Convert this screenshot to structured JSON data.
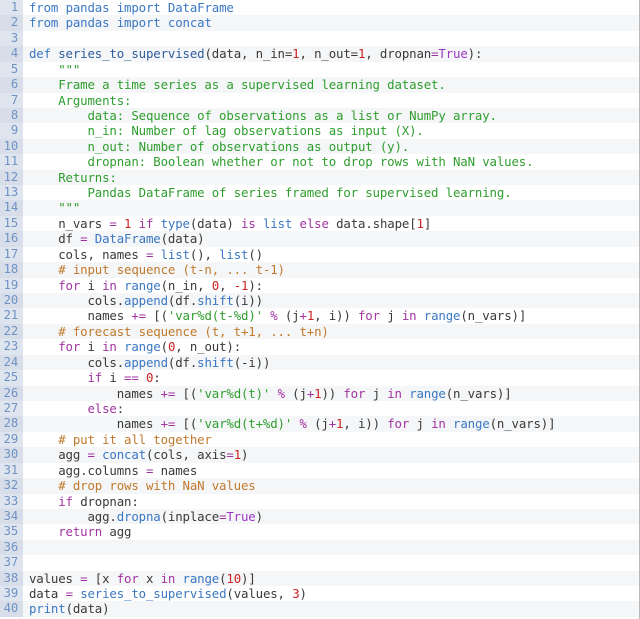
{
  "editor": {
    "name": "python-code-viewer",
    "language": "Python",
    "total_lines": 40,
    "first_line_number": 1,
    "theme": {
      "background": "#ffffff",
      "stripe_background": "#f5f6f7",
      "gutter_background": "#dfe5ee",
      "gutter_text": "#6f93c4",
      "keyword": "#3b78c3",
      "control_keyword": "#a234a2",
      "function": "#3b78c3",
      "number": "#cc2222",
      "constant": "#9b38c6",
      "string": "#2f9e2f",
      "comment": "#c07a2e",
      "plain_text": "#3a3a3a"
    }
  },
  "code": {
    "lines": [
      {
        "n": "1",
        "tokens": [
          {
            "t": "from ",
            "c": "kw"
          },
          {
            "t": "pandas ",
            "c": "fn"
          },
          {
            "t": "import ",
            "c": "kw"
          },
          {
            "t": "DataFrame",
            "c": "fn"
          }
        ]
      },
      {
        "n": "2",
        "tokens": [
          {
            "t": "from ",
            "c": "kw"
          },
          {
            "t": "pandas ",
            "c": "fn"
          },
          {
            "t": "import ",
            "c": "kw"
          },
          {
            "t": "concat",
            "c": "fn"
          }
        ]
      },
      {
        "n": "3",
        "tokens": []
      },
      {
        "n": "4",
        "tokens": [
          {
            "t": "def ",
            "c": "kw"
          },
          {
            "t": "series_to_supervised",
            "c": "def"
          },
          {
            "t": "(data, n_in=",
            "c": "plain"
          },
          {
            "t": "1",
            "c": "num"
          },
          {
            "t": ", n_out=",
            "c": "plain"
          },
          {
            "t": "1",
            "c": "num"
          },
          {
            "t": ", dropnan",
            "c": "plain"
          },
          {
            "t": "=",
            "c": "op"
          },
          {
            "t": "True",
            "c": "const"
          },
          {
            "t": "):",
            "c": "plain"
          }
        ]
      },
      {
        "n": "5",
        "tokens": [
          {
            "t": "    \"\"\"",
            "c": "str"
          }
        ]
      },
      {
        "n": "6",
        "tokens": [
          {
            "t": "    Frame a time series as a supervised learning dataset.",
            "c": "str"
          }
        ]
      },
      {
        "n": "7",
        "tokens": [
          {
            "t": "    Arguments:",
            "c": "str"
          }
        ]
      },
      {
        "n": "8",
        "tokens": [
          {
            "t": "        data: Sequence of observations as a list or NumPy array.",
            "c": "str"
          }
        ]
      },
      {
        "n": "9",
        "tokens": [
          {
            "t": "        n_in: Number of lag observations as input (X).",
            "c": "str"
          }
        ]
      },
      {
        "n": "10",
        "tokens": [
          {
            "t": "        n_out: Number of observations as output (y).",
            "c": "str"
          }
        ]
      },
      {
        "n": "11",
        "tokens": [
          {
            "t": "        dropnan: Boolean whether or not to drop rows with NaN values.",
            "c": "str"
          }
        ]
      },
      {
        "n": "12",
        "tokens": [
          {
            "t": "    Returns:",
            "c": "str"
          }
        ]
      },
      {
        "n": "13",
        "tokens": [
          {
            "t": "        Pandas DataFrame of series framed for supervised learning.",
            "c": "str"
          }
        ]
      },
      {
        "n": "14",
        "tokens": [
          {
            "t": "    \"\"\"",
            "c": "str"
          }
        ]
      },
      {
        "n": "15",
        "tokens": [
          {
            "t": "    n_vars ",
            "c": "plain"
          },
          {
            "t": "=",
            "c": "op"
          },
          {
            "t": " ",
            "c": "plain"
          },
          {
            "t": "1",
            "c": "num"
          },
          {
            "t": " ",
            "c": "plain"
          },
          {
            "t": "if ",
            "c": "ctrl"
          },
          {
            "t": "type",
            "c": "fn"
          },
          {
            "t": "(data) ",
            "c": "plain"
          },
          {
            "t": "is ",
            "c": "ctrl"
          },
          {
            "t": "list ",
            "c": "fn"
          },
          {
            "t": "else ",
            "c": "ctrl"
          },
          {
            "t": "data.shape[",
            "c": "plain"
          },
          {
            "t": "1",
            "c": "num"
          },
          {
            "t": "]",
            "c": "plain"
          }
        ]
      },
      {
        "n": "16",
        "tokens": [
          {
            "t": "    df ",
            "c": "plain"
          },
          {
            "t": "=",
            "c": "op"
          },
          {
            "t": " ",
            "c": "plain"
          },
          {
            "t": "DataFrame",
            "c": "fn"
          },
          {
            "t": "(data)",
            "c": "plain"
          }
        ]
      },
      {
        "n": "17",
        "tokens": [
          {
            "t": "    cols, names ",
            "c": "plain"
          },
          {
            "t": "=",
            "c": "op"
          },
          {
            "t": " ",
            "c": "plain"
          },
          {
            "t": "list",
            "c": "fn"
          },
          {
            "t": "(), ",
            "c": "plain"
          },
          {
            "t": "list",
            "c": "fn"
          },
          {
            "t": "()",
            "c": "plain"
          }
        ]
      },
      {
        "n": "18",
        "tokens": [
          {
            "t": "    # input sequence (t-n, ... t-1)",
            "c": "com"
          }
        ]
      },
      {
        "n": "19",
        "tokens": [
          {
            "t": "    ",
            "c": "plain"
          },
          {
            "t": "for ",
            "c": "ctrl"
          },
          {
            "t": "i ",
            "c": "plain"
          },
          {
            "t": "in ",
            "c": "ctrl"
          },
          {
            "t": "range",
            "c": "fn"
          },
          {
            "t": "(n_in, ",
            "c": "plain"
          },
          {
            "t": "0",
            "c": "num"
          },
          {
            "t": ", ",
            "c": "plain"
          },
          {
            "t": "-1",
            "c": "num"
          },
          {
            "t": "):",
            "c": "plain"
          }
        ]
      },
      {
        "n": "20",
        "tokens": [
          {
            "t": "        cols.",
            "c": "plain"
          },
          {
            "t": "append",
            "c": "fn"
          },
          {
            "t": "(df.",
            "c": "plain"
          },
          {
            "t": "shift",
            "c": "fn"
          },
          {
            "t": "(i))",
            "c": "plain"
          }
        ]
      },
      {
        "n": "21",
        "tokens": [
          {
            "t": "        names ",
            "c": "plain"
          },
          {
            "t": "+=",
            "c": "op"
          },
          {
            "t": " [(",
            "c": "plain"
          },
          {
            "t": "'var%d(t-%d)'",
            "c": "str"
          },
          {
            "t": " ",
            "c": "plain"
          },
          {
            "t": "%",
            "c": "op"
          },
          {
            "t": " (j",
            "c": "plain"
          },
          {
            "t": "+",
            "c": "op"
          },
          {
            "t": "1",
            "c": "num"
          },
          {
            "t": ", i)) ",
            "c": "plain"
          },
          {
            "t": "for ",
            "c": "ctrl"
          },
          {
            "t": "j ",
            "c": "plain"
          },
          {
            "t": "in ",
            "c": "ctrl"
          },
          {
            "t": "range",
            "c": "fn"
          },
          {
            "t": "(n_vars)]",
            "c": "plain"
          }
        ]
      },
      {
        "n": "22",
        "tokens": [
          {
            "t": "    # forecast sequence (t, t+1, ... t+n)",
            "c": "com"
          }
        ]
      },
      {
        "n": "23",
        "tokens": [
          {
            "t": "    ",
            "c": "plain"
          },
          {
            "t": "for ",
            "c": "ctrl"
          },
          {
            "t": "i ",
            "c": "plain"
          },
          {
            "t": "in ",
            "c": "ctrl"
          },
          {
            "t": "range",
            "c": "fn"
          },
          {
            "t": "(",
            "c": "plain"
          },
          {
            "t": "0",
            "c": "num"
          },
          {
            "t": ", n_out):",
            "c": "plain"
          }
        ]
      },
      {
        "n": "24",
        "tokens": [
          {
            "t": "        cols.",
            "c": "plain"
          },
          {
            "t": "append",
            "c": "fn"
          },
          {
            "t": "(df.",
            "c": "plain"
          },
          {
            "t": "shift",
            "c": "fn"
          },
          {
            "t": "(-i))",
            "c": "plain"
          }
        ]
      },
      {
        "n": "25",
        "tokens": [
          {
            "t": "        ",
            "c": "plain"
          },
          {
            "t": "if ",
            "c": "ctrl"
          },
          {
            "t": "i ",
            "c": "plain"
          },
          {
            "t": "==",
            "c": "op"
          },
          {
            "t": " ",
            "c": "plain"
          },
          {
            "t": "0",
            "c": "num"
          },
          {
            "t": ":",
            "c": "plain"
          }
        ]
      },
      {
        "n": "26",
        "tokens": [
          {
            "t": "            names ",
            "c": "plain"
          },
          {
            "t": "+=",
            "c": "op"
          },
          {
            "t": " [(",
            "c": "plain"
          },
          {
            "t": "'var%d(t)'",
            "c": "str"
          },
          {
            "t": " ",
            "c": "plain"
          },
          {
            "t": "%",
            "c": "op"
          },
          {
            "t": " (j",
            "c": "plain"
          },
          {
            "t": "+",
            "c": "op"
          },
          {
            "t": "1",
            "c": "num"
          },
          {
            "t": ")) ",
            "c": "plain"
          },
          {
            "t": "for ",
            "c": "ctrl"
          },
          {
            "t": "j ",
            "c": "plain"
          },
          {
            "t": "in ",
            "c": "ctrl"
          },
          {
            "t": "range",
            "c": "fn"
          },
          {
            "t": "(n_vars)]",
            "c": "plain"
          }
        ]
      },
      {
        "n": "27",
        "tokens": [
          {
            "t": "        ",
            "c": "plain"
          },
          {
            "t": "else",
            "c": "ctrl"
          },
          {
            "t": ":",
            "c": "plain"
          }
        ]
      },
      {
        "n": "28",
        "tokens": [
          {
            "t": "            names ",
            "c": "plain"
          },
          {
            "t": "+=",
            "c": "op"
          },
          {
            "t": " [(",
            "c": "plain"
          },
          {
            "t": "'var%d(t+%d)'",
            "c": "str"
          },
          {
            "t": " ",
            "c": "plain"
          },
          {
            "t": "%",
            "c": "op"
          },
          {
            "t": " (j",
            "c": "plain"
          },
          {
            "t": "+",
            "c": "op"
          },
          {
            "t": "1",
            "c": "num"
          },
          {
            "t": ", i)) ",
            "c": "plain"
          },
          {
            "t": "for ",
            "c": "ctrl"
          },
          {
            "t": "j ",
            "c": "plain"
          },
          {
            "t": "in ",
            "c": "ctrl"
          },
          {
            "t": "range",
            "c": "fn"
          },
          {
            "t": "(n_vars)]",
            "c": "plain"
          }
        ]
      },
      {
        "n": "29",
        "tokens": [
          {
            "t": "    # put it all together",
            "c": "com"
          }
        ]
      },
      {
        "n": "30",
        "tokens": [
          {
            "t": "    agg ",
            "c": "plain"
          },
          {
            "t": "=",
            "c": "op"
          },
          {
            "t": " ",
            "c": "plain"
          },
          {
            "t": "concat",
            "c": "fn"
          },
          {
            "t": "(cols, axis",
            "c": "plain"
          },
          {
            "t": "=",
            "c": "op"
          },
          {
            "t": "1",
            "c": "num"
          },
          {
            "t": ")",
            "c": "plain"
          }
        ]
      },
      {
        "n": "31",
        "tokens": [
          {
            "t": "    agg.columns ",
            "c": "plain"
          },
          {
            "t": "=",
            "c": "op"
          },
          {
            "t": " names",
            "c": "plain"
          }
        ]
      },
      {
        "n": "32",
        "tokens": [
          {
            "t": "    # drop rows with NaN values",
            "c": "com"
          }
        ]
      },
      {
        "n": "33",
        "tokens": [
          {
            "t": "    ",
            "c": "plain"
          },
          {
            "t": "if ",
            "c": "ctrl"
          },
          {
            "t": "dropnan:",
            "c": "plain"
          }
        ]
      },
      {
        "n": "34",
        "tokens": [
          {
            "t": "        agg.",
            "c": "plain"
          },
          {
            "t": "dropna",
            "c": "fn"
          },
          {
            "t": "(inplace",
            "c": "plain"
          },
          {
            "t": "=",
            "c": "op"
          },
          {
            "t": "True",
            "c": "const"
          },
          {
            "t": ")",
            "c": "plain"
          }
        ]
      },
      {
        "n": "35",
        "tokens": [
          {
            "t": "    ",
            "c": "plain"
          },
          {
            "t": "return ",
            "c": "ctrl"
          },
          {
            "t": "agg",
            "c": "plain"
          }
        ]
      },
      {
        "n": "36",
        "tokens": []
      },
      {
        "n": "37",
        "tokens": []
      },
      {
        "n": "38",
        "tokens": [
          {
            "t": "values ",
            "c": "plain"
          },
          {
            "t": "=",
            "c": "op"
          },
          {
            "t": " [x ",
            "c": "plain"
          },
          {
            "t": "for ",
            "c": "ctrl"
          },
          {
            "t": "x ",
            "c": "plain"
          },
          {
            "t": "in ",
            "c": "ctrl"
          },
          {
            "t": "range",
            "c": "fn"
          },
          {
            "t": "(",
            "c": "plain"
          },
          {
            "t": "10",
            "c": "num"
          },
          {
            "t": ")]",
            "c": "plain"
          }
        ]
      },
      {
        "n": "39",
        "tokens": [
          {
            "t": "data ",
            "c": "plain"
          },
          {
            "t": "=",
            "c": "op"
          },
          {
            "t": " ",
            "c": "plain"
          },
          {
            "t": "series_to_supervised",
            "c": "fn"
          },
          {
            "t": "(values, ",
            "c": "plain"
          },
          {
            "t": "3",
            "c": "num"
          },
          {
            "t": ")",
            "c": "plain"
          }
        ]
      },
      {
        "n": "40",
        "tokens": [
          {
            "t": "print",
            "c": "fn"
          },
          {
            "t": "(data)",
            "c": "plain"
          }
        ]
      }
    ]
  }
}
